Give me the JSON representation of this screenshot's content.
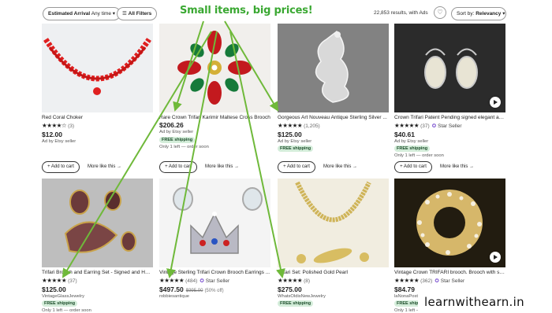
{
  "toolbar": {
    "filter_estimated": "Estimated Arrival",
    "filter_anytime": "Any time",
    "all_filters": "All Filters",
    "results_text": "22,853 results, with Ads",
    "sort_prefix": "Sort by:",
    "sort_value": "Relevancy"
  },
  "headline": "Small items, big prices!",
  "watermark": "learnwithearn.in",
  "labels": {
    "add_to_cart": "+ Add to cart",
    "more_like_this": "More like this →"
  },
  "products": [
    {
      "title": "Red Coral Choker",
      "stars": "★★★★☆",
      "count": "(3)",
      "star_seller": "",
      "price": "$12.00",
      "orig_price": "",
      "discount": "",
      "meta1": "Ad by Etsy seller",
      "free_shipping": "",
      "meta2": ""
    },
    {
      "title": "Rare Crown Trifari Karimir Maltese Cross Brooch",
      "stars": "",
      "count": "",
      "star_seller": "",
      "price": "$206.26",
      "orig_price": "",
      "discount": "",
      "meta1": "Ad by Etsy seller",
      "free_shipping": "FREE shipping",
      "meta2": "Only 1 left — order soon"
    },
    {
      "title": "Gorgeous Art Nouveau Antique Sterling Silver ...",
      "stars": "★★★★★",
      "count": "(1,205)",
      "star_seller": "",
      "price": "$125.00",
      "orig_price": "",
      "discount": "",
      "meta1": "Ad by Etsy seller",
      "free_shipping": "FREE shipping",
      "meta2": ""
    },
    {
      "title": "Crown Trifari Patent Pending signed elegant an...",
      "stars": "★★★★★",
      "count": "(37)",
      "star_seller": "Star Seller",
      "price": "$40.61",
      "orig_price": "",
      "discount": "",
      "meta1": "Ad by Etsy seller",
      "free_shipping": "FREE shipping",
      "meta2": "Only 1 left — order soon"
    },
    {
      "title": "Trifari Brooch and Earring Set - Signed and Hall...",
      "stars": "★★★★★",
      "count": "(37)",
      "star_seller": "",
      "price": "$125.00",
      "orig_price": "",
      "discount": "",
      "meta1": "VintageGlassJewelry",
      "free_shipping": "FREE shipping",
      "meta2": "Only 1 left — order soon"
    },
    {
      "title": "Vintage Sterling Trifari Crown Brooch Earrings ...",
      "stars": "★★★★★",
      "count": "(484)",
      "star_seller": "Star Seller",
      "price": "$497.50",
      "orig_price": "$995.00",
      "discount": "(50% off)",
      "meta1": "robbiesantique",
      "free_shipping": "",
      "meta2": ""
    },
    {
      "title": "Trifari Set: Polished Gold Pearl",
      "stars": "★★★★★",
      "count": "(8)",
      "star_seller": "",
      "price": "$275.00",
      "orig_price": "",
      "discount": "",
      "meta1": "WhatsOldisNewJewelry",
      "free_shipping": "FREE shipping",
      "meta2": ""
    },
    {
      "title": "Vintage Crown TRIFARI brooch. Brooch with sa...",
      "stars": "★★★★★",
      "count": "(362)",
      "star_seller": "Star Seller",
      "price": "$84.79",
      "orig_price": "",
      "discount": "",
      "meta1": "laNonaPosta",
      "free_shipping": "FREE shipping",
      "meta2": "Only 1 left — order soon"
    }
  ],
  "colors": {
    "annotation_green": "#6fb93a",
    "headline_green": "#3aa832",
    "free_shipping_bg": "#d4edda",
    "star_seller_purple": "#7a4fd0"
  }
}
